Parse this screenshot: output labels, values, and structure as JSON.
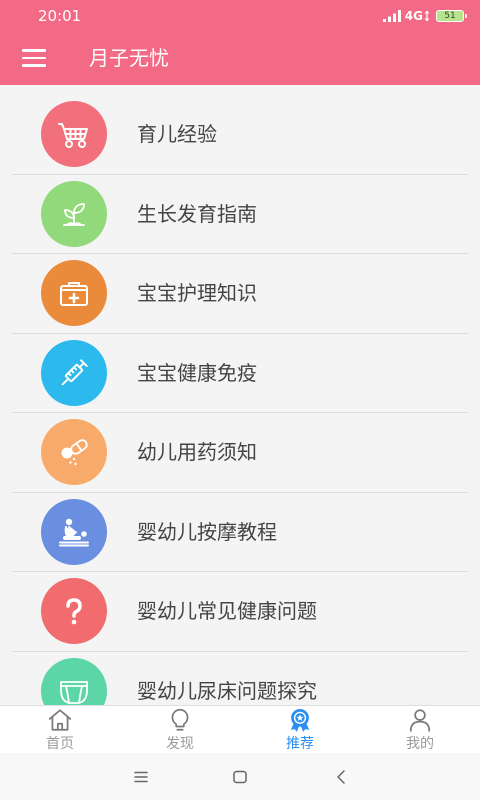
{
  "theme": {
    "primary": "#f26a85",
    "accent": "#2b8ef3"
  },
  "status_bar": {
    "time": "20:01",
    "network": "4G",
    "battery": "51"
  },
  "app_bar": {
    "title": "月子无忧",
    "menu_icon": "hamburger-menu-icon"
  },
  "list": {
    "items": [
      {
        "label": "育儿经验",
        "icon": "stroller-icon",
        "color": "#f2707b"
      },
      {
        "label": "生长发育指南",
        "icon": "sprout-icon",
        "color": "#92d97c"
      },
      {
        "label": "宝宝护理知识",
        "icon": "medical-kit-icon",
        "color": "#ea8b3c"
      },
      {
        "label": "宝宝健康免疫",
        "icon": "syringe-icon",
        "color": "#2bb9ee"
      },
      {
        "label": "幼儿用药须知",
        "icon": "pills-icon",
        "color": "#f8aa6b"
      },
      {
        "label": "婴幼儿按摩教程",
        "icon": "massage-icon",
        "color": "#6b8fe0"
      },
      {
        "label": "婴幼儿常见健康问题",
        "icon": "question-icon",
        "color": "#f06c6e"
      },
      {
        "label": "婴幼儿尿床问题探究",
        "icon": "diaper-icon",
        "color": "#5cd6a7"
      }
    ]
  },
  "bottom_nav": {
    "tabs": [
      {
        "label": "首页",
        "icon": "home-icon",
        "active": false
      },
      {
        "label": "发现",
        "icon": "lightbulb-icon",
        "active": false
      },
      {
        "label": "推荐",
        "icon": "badge-icon",
        "active": true
      },
      {
        "label": "我的",
        "icon": "person-icon",
        "active": false
      }
    ]
  },
  "system_nav": {
    "buttons": [
      "recent-apps-icon",
      "home-square-icon",
      "back-icon"
    ]
  }
}
